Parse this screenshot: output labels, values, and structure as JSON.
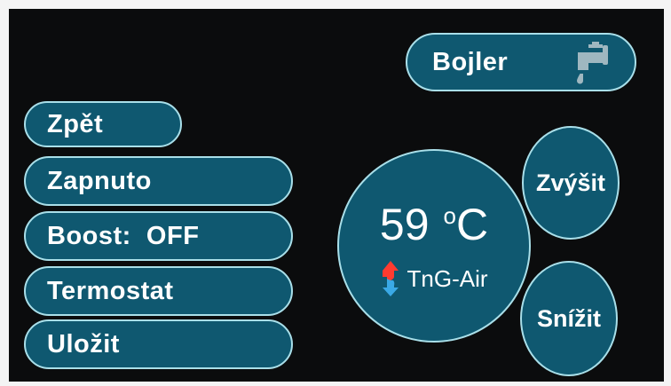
{
  "header": {
    "title": "Bojler",
    "icon": "faucet-icon"
  },
  "menu": {
    "items": [
      {
        "key": "back",
        "label": "Zpět"
      },
      {
        "key": "power",
        "label": "Zapnuto"
      },
      {
        "key": "boost",
        "label": "Boost:  OFF"
      },
      {
        "key": "thermostat",
        "label": "Termostat"
      },
      {
        "key": "save",
        "label": "Uložit"
      }
    ]
  },
  "display": {
    "temperature": "59",
    "unit_degree": "o",
    "unit_letter": "C",
    "mode": "TnG-Air",
    "mode_icon": "heat-pump-arrows-icon"
  },
  "controls": {
    "increase": "Zvýšit",
    "decrease": "Snížit"
  },
  "colors": {
    "background": "#0b0c0d",
    "button_fill": "#0f5870",
    "button_border": "#a9dfe9",
    "text": "#ffffff",
    "arrow_up": "#ff3b30",
    "arrow_down": "#3aa9e6"
  }
}
